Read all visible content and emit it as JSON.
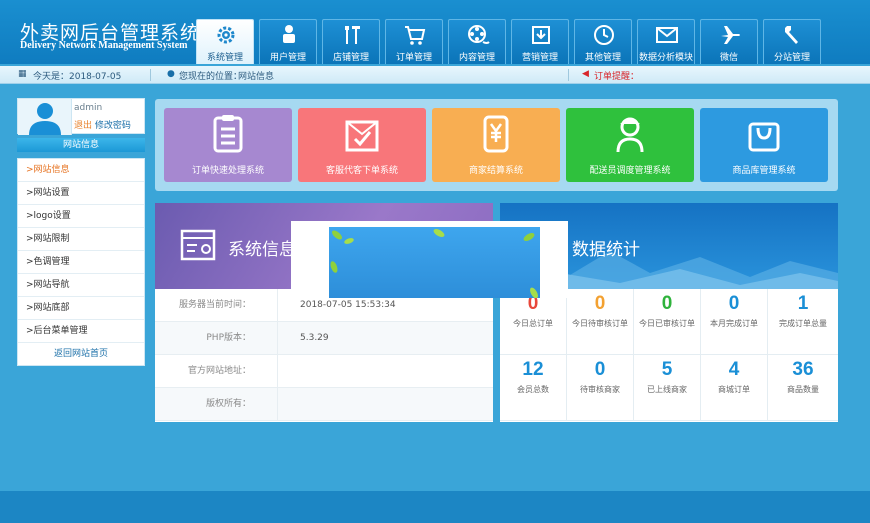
{
  "header": {
    "title_cn": "外卖网后台管理系统",
    "title_en": "Delivery Network Management System",
    "nav": [
      {
        "label": "系统管理",
        "icon": "gear-icon",
        "active": true
      },
      {
        "label": "用户管理",
        "icon": "user-icon"
      },
      {
        "label": "店铺管理",
        "icon": "tools-icon"
      },
      {
        "label": "订单管理",
        "icon": "cart-icon"
      },
      {
        "label": "内容管理",
        "icon": "film-reel-icon"
      },
      {
        "label": "营销管理",
        "icon": "download-box-icon"
      },
      {
        "label": "其他管理",
        "icon": "clock-icon"
      },
      {
        "label": "数据分析模块",
        "icon": "envelope-icon"
      },
      {
        "label": "微信",
        "icon": "airplane-icon"
      },
      {
        "label": "分站管理",
        "icon": "wrench-icon"
      }
    ]
  },
  "infobar": {
    "today": "今天是：2018-07-05",
    "location_label": "您现在的位置：",
    "location": "网站信息",
    "order_alert": "订单提醒："
  },
  "user": {
    "name": "admin",
    "logout": "退出",
    "change_password": "修改密码"
  },
  "sidebar": {
    "title": "网站信息",
    "items": [
      {
        "label": ">网站信息",
        "active": true
      },
      {
        "label": ">网站设置"
      },
      {
        "label": ">logo设置"
      },
      {
        "label": ">网站限制"
      },
      {
        "label": ">色调管理"
      },
      {
        "label": ">网站导航"
      },
      {
        "label": ">网站底部"
      },
      {
        "label": ">后台菜单管理"
      }
    ],
    "footer": "返回网站首页"
  },
  "tiles": [
    {
      "label": "订单快速处理系统",
      "color": "#a688d0",
      "icon": "clipboard-icon"
    },
    {
      "label": "客服代客下单系统",
      "color": "#f8767a",
      "icon": "envelope-check-icon"
    },
    {
      "label": "商家结算系统",
      "color": "#f8ae52",
      "icon": "receipt-yen-icon"
    },
    {
      "label": "配送员调度管理系统",
      "color": "#2fc13d",
      "icon": "courier-icon"
    },
    {
      "label": "商品库管理系统",
      "color": "#2d9ae0",
      "icon": "shopping-bag-icon"
    }
  ],
  "system": {
    "title": "系统信息",
    "rows": [
      {
        "key": "服务器当前时间：",
        "value": "2018-07-05 15:53:34"
      },
      {
        "key": "PHP版本：",
        "value": "5.3.29"
      },
      {
        "key": "官方网站地址：",
        "value": ""
      },
      {
        "key": "版权所有：",
        "value": ""
      }
    ]
  },
  "stats": {
    "title": "数据统计",
    "items": [
      {
        "value": "0",
        "label": "今日总订单",
        "color": "#e8473a"
      },
      {
        "value": "0",
        "label": "今日待审核订单",
        "color": "#f3a131"
      },
      {
        "value": "0",
        "label": "今日已审核订单",
        "color": "#2fb33c"
      },
      {
        "value": "0",
        "label": "本月完成订单",
        "color": "#1a8fd6"
      },
      {
        "value": "1",
        "label": "完成订单总量",
        "color": "#1a8fd6"
      },
      {
        "value": "12",
        "label": "会员总数",
        "color": "#1a8fd6"
      },
      {
        "value": "0",
        "label": "待审核商家",
        "color": "#1a8fd6"
      },
      {
        "value": "5",
        "label": "已上线商家",
        "color": "#1a8fd6"
      },
      {
        "value": "4",
        "label": "商城订单",
        "color": "#1a8fd6"
      },
      {
        "value": "36",
        "label": "商品数量",
        "color": "#1a8fd6"
      }
    ]
  }
}
